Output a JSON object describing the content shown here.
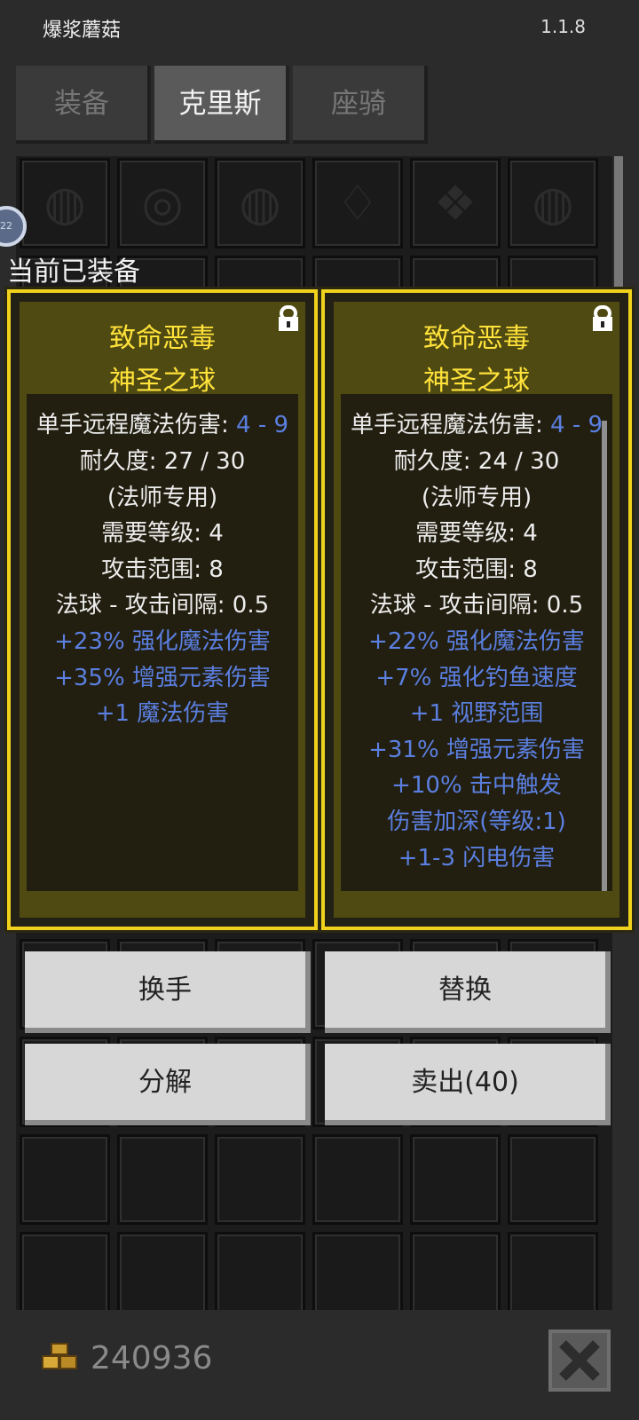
{
  "app": {
    "title": "爆浆蘑菇",
    "version": "1.1.8"
  },
  "tabs": [
    {
      "label": "装备",
      "active": false
    },
    {
      "label": "克里斯",
      "active": true
    },
    {
      "label": "座骑",
      "active": false
    }
  ],
  "badge": "22",
  "equipped_label": "当前已装备",
  "cards": [
    {
      "title_line1": "致命恶毒",
      "title_line2": "神圣之球",
      "damage_label": "单手远程魔法伤害: ",
      "damage_value": "4 - 9",
      "stats": [
        {
          "text": "耐久度: 27 / 30",
          "color": "white"
        },
        {
          "text": "(法师专用)",
          "color": "white"
        },
        {
          "text": "需要等级: 4",
          "color": "white"
        },
        {
          "text": "攻击范围: 8",
          "color": "white"
        },
        {
          "text": "法球 - 攻击间隔: 0.5",
          "color": "white"
        },
        {
          "text": "+23% 强化魔法伤害",
          "color": "blue"
        },
        {
          "text": "+35% 增强元素伤害",
          "color": "blue"
        },
        {
          "text": "+1 魔法伤害",
          "color": "blue"
        }
      ]
    },
    {
      "title_line1": "致命恶毒",
      "title_line2": "神圣之球",
      "damage_label": "单手远程魔法伤害: ",
      "damage_value": "4 - 9",
      "stats": [
        {
          "text": "耐久度: 24 / 30",
          "color": "white"
        },
        {
          "text": "(法师专用)",
          "color": "white"
        },
        {
          "text": "需要等级: 4",
          "color": "white"
        },
        {
          "text": "攻击范围: 8",
          "color": "white"
        },
        {
          "text": "法球 - 攻击间隔: 0.5",
          "color": "white"
        },
        {
          "text": "+22% 强化魔法伤害",
          "color": "blue"
        },
        {
          "text": "+7% 强化钓鱼速度",
          "color": "blue"
        },
        {
          "text": "+1 视野范围",
          "color": "blue"
        },
        {
          "text": "+31% 增强元素伤害",
          "color": "blue"
        },
        {
          "text": "+10% 击中触发",
          "color": "blue"
        },
        {
          "text": "伤害加深(等级:1)",
          "color": "blue"
        },
        {
          "text": "+1-3 闪电伤害",
          "color": "blue"
        }
      ]
    }
  ],
  "buttons": {
    "swap_hand": "换手",
    "replace": "替换",
    "disassemble": "分解",
    "sell": "卖出(40)"
  },
  "gold": "240936",
  "colors": {
    "title_yellow": "#ffe23a",
    "stat_blue": "#5b7fe0",
    "card_border": "#f0d21c"
  },
  "icons": {
    "gold": "gold-coins-icon",
    "close": "close-icon",
    "lock": "lock-icon"
  }
}
